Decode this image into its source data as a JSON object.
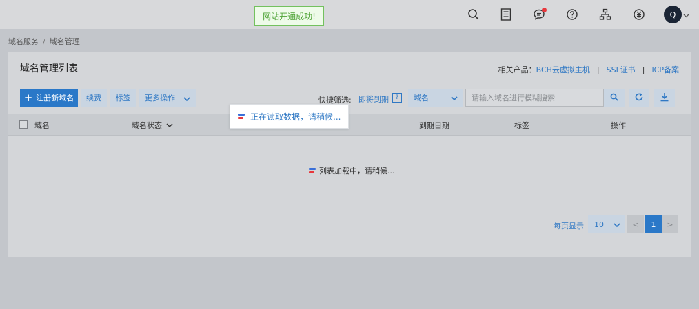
{
  "toast": {
    "text": "网站开通成功!"
  },
  "topbar": {
    "icons": [
      "search-icon",
      "orders-icon",
      "message-icon",
      "help-icon",
      "network-icon",
      "billing-icon"
    ],
    "avatar_letter": "Q"
  },
  "breadcrumb": {
    "items": [
      "域名服务",
      "域名管理"
    ],
    "separator": "/"
  },
  "panel": {
    "title": "域名管理列表",
    "related_label": "相关产品：",
    "related_links": [
      "BCH云虚拟主机",
      "SSL证书",
      "ICP备案"
    ],
    "related_separator": "|"
  },
  "toolbar": {
    "register_label": "注册新域名",
    "renew_label": "续费",
    "tag_label": "标签",
    "more_label": "更多操作",
    "quick_filter_label": "快捷筛选:",
    "quick_filter_link": "即将到期",
    "help_mark": "?",
    "select_value": "域名",
    "search_placeholder": "请输入域名进行模糊搜索"
  },
  "table": {
    "columns": [
      "域名",
      "域名状态",
      "到期日期",
      "标签",
      "操作"
    ],
    "loading_text": "列表加载中，请稍候..."
  },
  "pagination": {
    "per_page_label": "每页显示",
    "per_page_value": "10",
    "prev": "<",
    "current": "1",
    "next": ">"
  },
  "popup": {
    "text": "正在读取数据，请稍候..."
  },
  "colors": {
    "accent": "#2a78c8",
    "link": "#2f78c4",
    "success": "#4ea336",
    "alert": "#e8383d"
  }
}
